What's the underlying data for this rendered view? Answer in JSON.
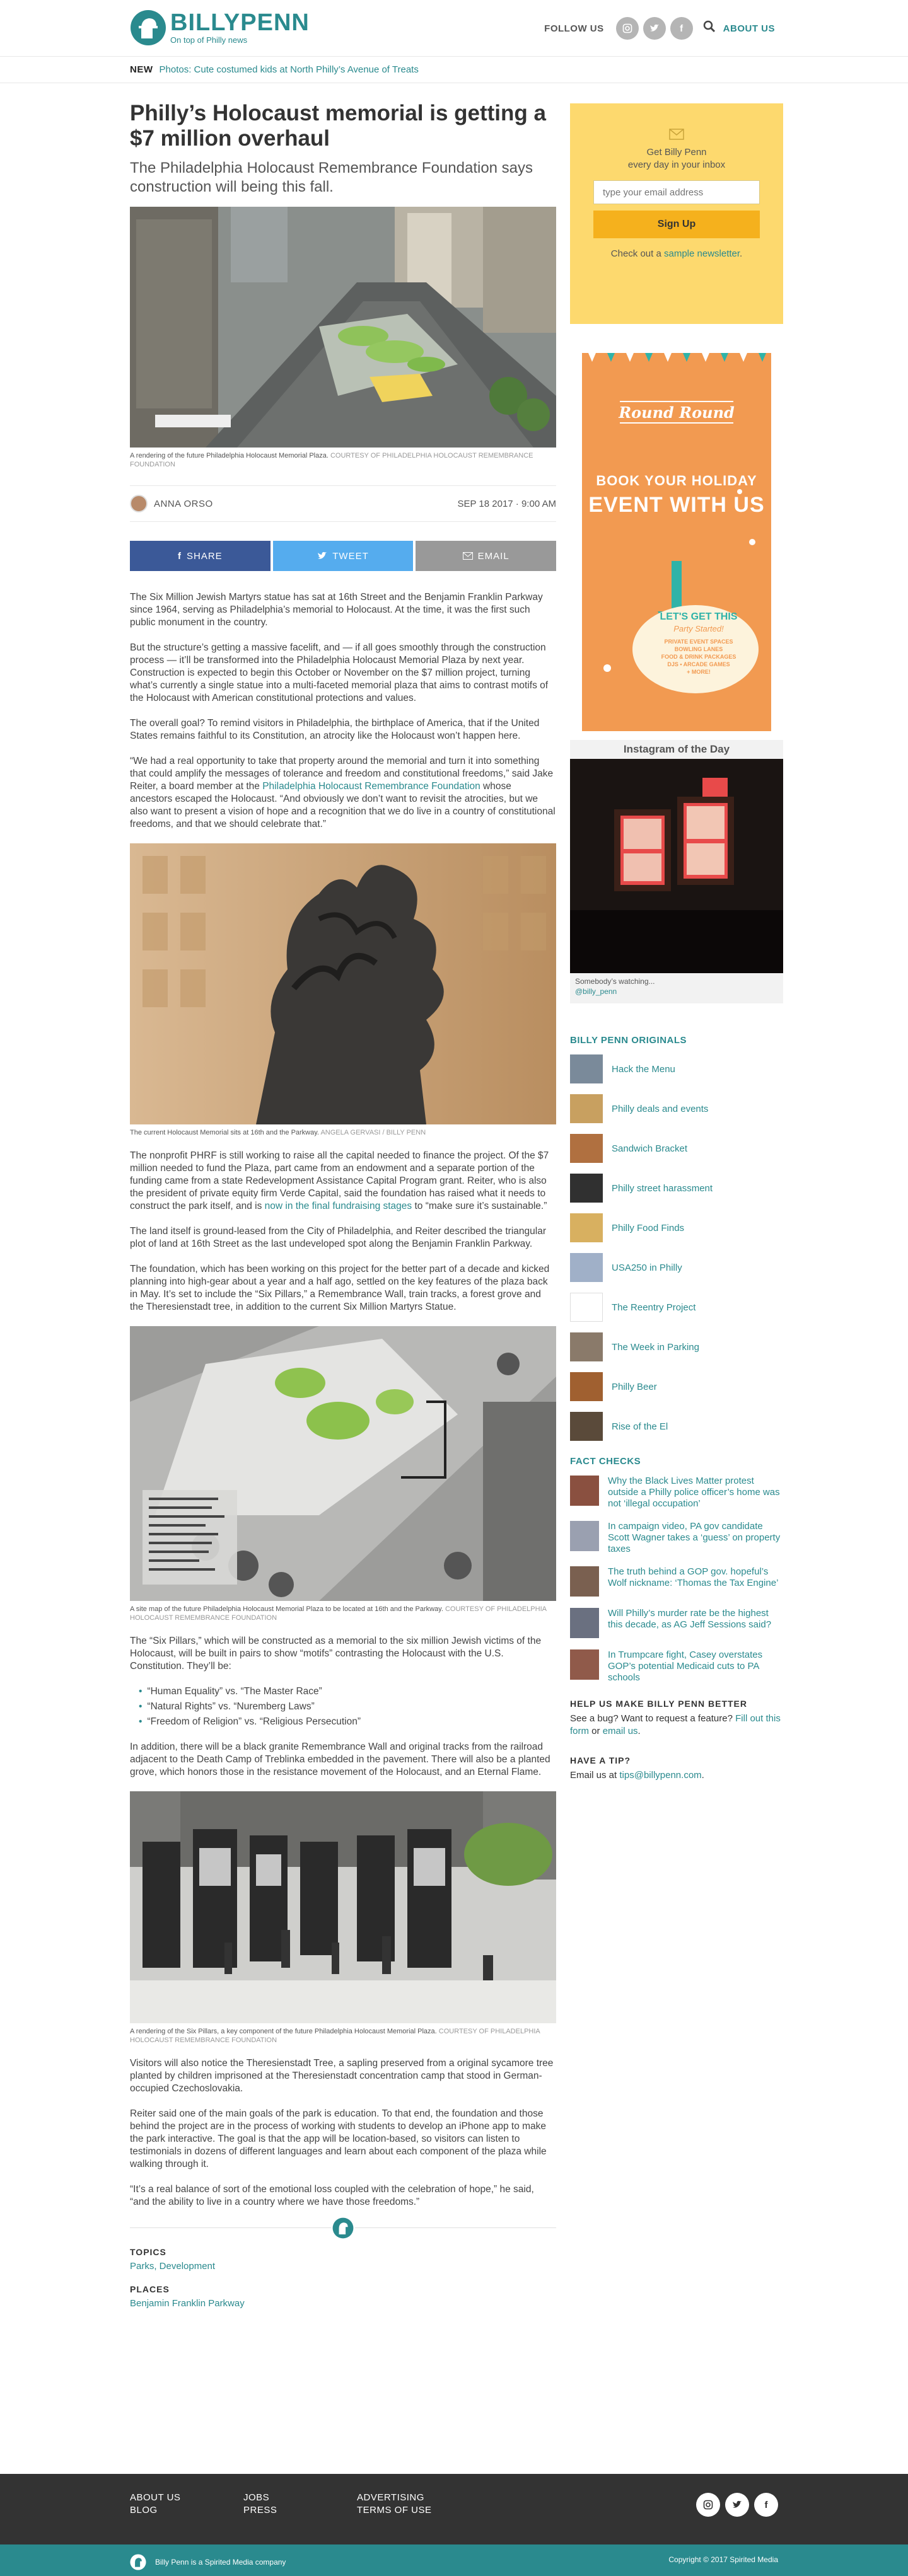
{
  "header": {
    "logo_name": "BILLYPENN",
    "logo_tag": "On top of Philly news",
    "follow_label": "FOLLOW US",
    "social": [
      "ig",
      "tw",
      "f"
    ],
    "about_label": "ABOUT US"
  },
  "newbar": {
    "label": "NEW",
    "link": "Photos: Cute costumed kids at North Philly’s Avenue of Treats"
  },
  "article": {
    "title": "Philly’s Holocaust memorial is getting a $7 million overhaul",
    "dek": "The Philadelphia Holocaust Remembrance Foundation says construction will being this fall.",
    "hero_caption": "A rendering of the future Philadelphia Holocaust Memorial Plaza.",
    "hero_credit": "COURTESY OF PHILADELPHIA HOLOCAUST REMEMBRANCE FOUNDATION",
    "author": "ANNA ORSO",
    "date": "SEP 18 2017 · 9:00 AM",
    "share_fb": "SHARE",
    "share_tw": "TWEET",
    "share_em": "EMAIL",
    "p1": "The Six Million Jewish Martyrs statue has sat at 16th Street and the Benjamin Franklin Parkway since 1964, serving as Philadelphia’s memorial to Holocaust. At the time, it was the first such public monument in the country.",
    "p2": "But the structure’s getting a massive facelift, and — if all goes smoothly through the construction process — it’ll be transformed into the Philadelphia Holocaust Memorial Plaza by next year. Construction is expected to begin this October or November on the $7 million project, turning what’s currently a single statue into a multi-faceted memorial plaza that aims to contrast motifs of the Holocaust with American constitutional protections and values.",
    "p3": "The overall goal? To remind visitors in Philadelphia, the birthplace of America, that if the United States remains faithful to its Constitution, an atrocity like the Holocaust won’t happen here.",
    "p4a": "“We had a real opportunity to take that property around the memorial and turn it into something that could amplify the messages of tolerance and freedom and constitutional freedoms,” said Jake Reiter, a board member at the ",
    "p4link": "Philadelphia Holocaust Remembrance Foundation",
    "p4b": " whose ancestors escaped the Holocaust. “And obviously we don’t want to revisit the atrocities, but we also want to present a vision of hope and a recognition that we do live in a country of constitutional freedoms, and that we should celebrate that.”",
    "img2_caption": "The current Holocaust Memorial sits at 16th and the Parkway.",
    "img2_credit": "ANGELA GERVASI / BILLY PENN",
    "p5a": "The nonprofit PHRF is still working to raise all the capital needed to finance the project. Of the $7 million needed to fund the Plaza, part came from an endowment and a separate portion of the funding came from a state Redevelopment Assistance Capital Program grant. Reiter, who is also the president of private equity firm Verde Capital, said the foundation has raised what it needs to construct the park itself, and is ",
    "p5link": "now in the final fundraising stages",
    "p5b": " to “make sure it’s sustainable.”",
    "p6": "The land itself is ground-leased from the City of Philadelphia, and Reiter described the triangular plot of land at 16th Street as the last undeveloped spot along the Benjamin Franklin Parkway.",
    "p7": "The foundation, which has been working on this project for the better part of a decade and kicked planning into high-gear about a year and a half ago, settled on the key features of the plaza back in May. It’s set to include the “Six Pillars,” a Remembrance Wall, train tracks, a forest grove and the Theresienstadt tree, in addition to the current Six Million Martyrs Statue.",
    "img3_caption": "A site map of the future Philadelphia Holocaust Memorial Plaza to be located at 16th and the Parkway.",
    "img3_credit": "COURTESY OF PHILADELPHIA HOLOCAUST REMEMBRANCE FOUNDATION",
    "p8": "The “Six Pillars,” which will be constructed as a memorial to the six million Jewish victims of the Holocaust, will be built in pairs to show “motifs” contrasting the Holocaust with the U.S. Constitution. They’ll be:",
    "bullets": [
      "“Human Equality” vs. “The Master Race”",
      "“Natural Rights” vs. “Nuremberg Laws”",
      "“Freedom of Religion” vs. “Religious Persecution”"
    ],
    "p9": "In addition, there will be a black granite Remembrance Wall and original tracks from the railroad adjacent to the Death Camp of Treblinka embedded in the pavement. There will also be a planted grove, which honors those in the resistance movement of the Holocaust, and an Eternal Flame.",
    "img4_caption": "A rendering of the Six Pillars, a key component of the future Philadelphia Holocaust Memorial Plaza.",
    "img4_credit": "COURTESY OF PHILADELPHIA HOLOCAUST REMEMBRANCE FOUNDATION",
    "p10": "Visitors will also notice the Theresienstadt Tree, a sapling preserved from a original sycamore tree planted by children imprisoned at the Theresienstadt concentration camp that stood in German-occupied Czechoslovakia.",
    "p11": "Reiter said one of the main goals of the park is education. To that end, the foundation and those behind the project are in the process of working with students to develop an iPhone app to make the park interactive. The goal is that the app will be location-based, so visitors can listen to testimonials in dozens of different languages and learn about each component of the plaza while walking through it.",
    "p12": "“It’s a real balance of sort of the emotional loss coupled with the celebration of hope,” he said, “and the ability to live in a country where we have those freedoms.”",
    "topics_label": "TOPICS",
    "topics": "Parks, Development",
    "places_label": "PLACES",
    "places": "Benjamin Franklin Parkway"
  },
  "sidebar": {
    "nl_line1": "Get Billy Penn",
    "nl_line2": "every day in your inbox",
    "nl_placeholder": "type your email address",
    "nl_button": "Sign Up",
    "nl_check_a": "Check out a ",
    "nl_check_link": "sample newsletter",
    "nl_check_b": ".",
    "ad": {
      "brand": "Round Round",
      "line1": "BOOK YOUR HOLIDAY",
      "line2": "EVENT WITH US",
      "badge1": "LET'S GET THIS",
      "badge2": "Party Started!",
      "list": [
        "PRIVATE EVENT SPACES",
        "BOWLING LANES",
        "FOOD & DRINK PACKAGES",
        "DJS • ARCADE GAMES",
        "+ MORE!"
      ]
    },
    "ig_title": "Instagram of the Day",
    "ig_caption": "Somebody’s watching...",
    "ig_handle": "@billy_penn",
    "originals_label": "BILLY PENN ORIGINALS",
    "originals": [
      "Hack the Menu",
      "Philly deals and events",
      "Sandwich Bracket",
      "Philly street harassment",
      "Philly Food Finds",
      "USA250 in Philly",
      "The Reentry Project",
      "The Week in Parking",
      "Philly Beer",
      "Rise of the El"
    ],
    "factchecks_label": "FACT CHECKS",
    "factchecks": [
      "Why the Black Lives Matter protest outside a Philly police officer’s home was not ‘illegal occupation’",
      "In campaign video, PA gov candidate Scott Wagner takes a ‘guess’ on property taxes",
      "The truth behind a GOP gov. hopeful’s Wolf nickname: ‘Thomas the Tax Engine’",
      "Will Philly’s murder rate be the highest this decade, as AG Jeff Sessions said?",
      "In Trumpcare fight, Casey overstates GOP’s potential Medicaid cuts to PA schools"
    ],
    "help_label": "HELP US MAKE BILLY PENN BETTER",
    "help_a": "See a bug? Want to request a feature? ",
    "help_link1": "Fill out this form",
    "help_b": " or ",
    "help_link2": "email us",
    "help_c": ".",
    "tip_label": "HAVE A TIP?",
    "tip_a": "Email us at ",
    "tip_link": "tips@billypenn.com",
    "tip_b": "."
  },
  "footer": {
    "col1": [
      "ABOUT US",
      "BLOG"
    ],
    "col2": [
      "JOBS",
      "PRESS"
    ],
    "col3": [
      "ADVERTISING",
      "TERMS OF USE"
    ],
    "social": [
      "ig",
      "tw",
      "f"
    ],
    "bottom_left": "Billy Penn is a Spirited Media company",
    "bottom_right": "Copyright © 2017 Spirited Media"
  },
  "colors": {
    "accent": "#2a8a8e",
    "facebook": "#3b5998",
    "twitter": "#55acee",
    "newsletter": "#fdd96e"
  }
}
